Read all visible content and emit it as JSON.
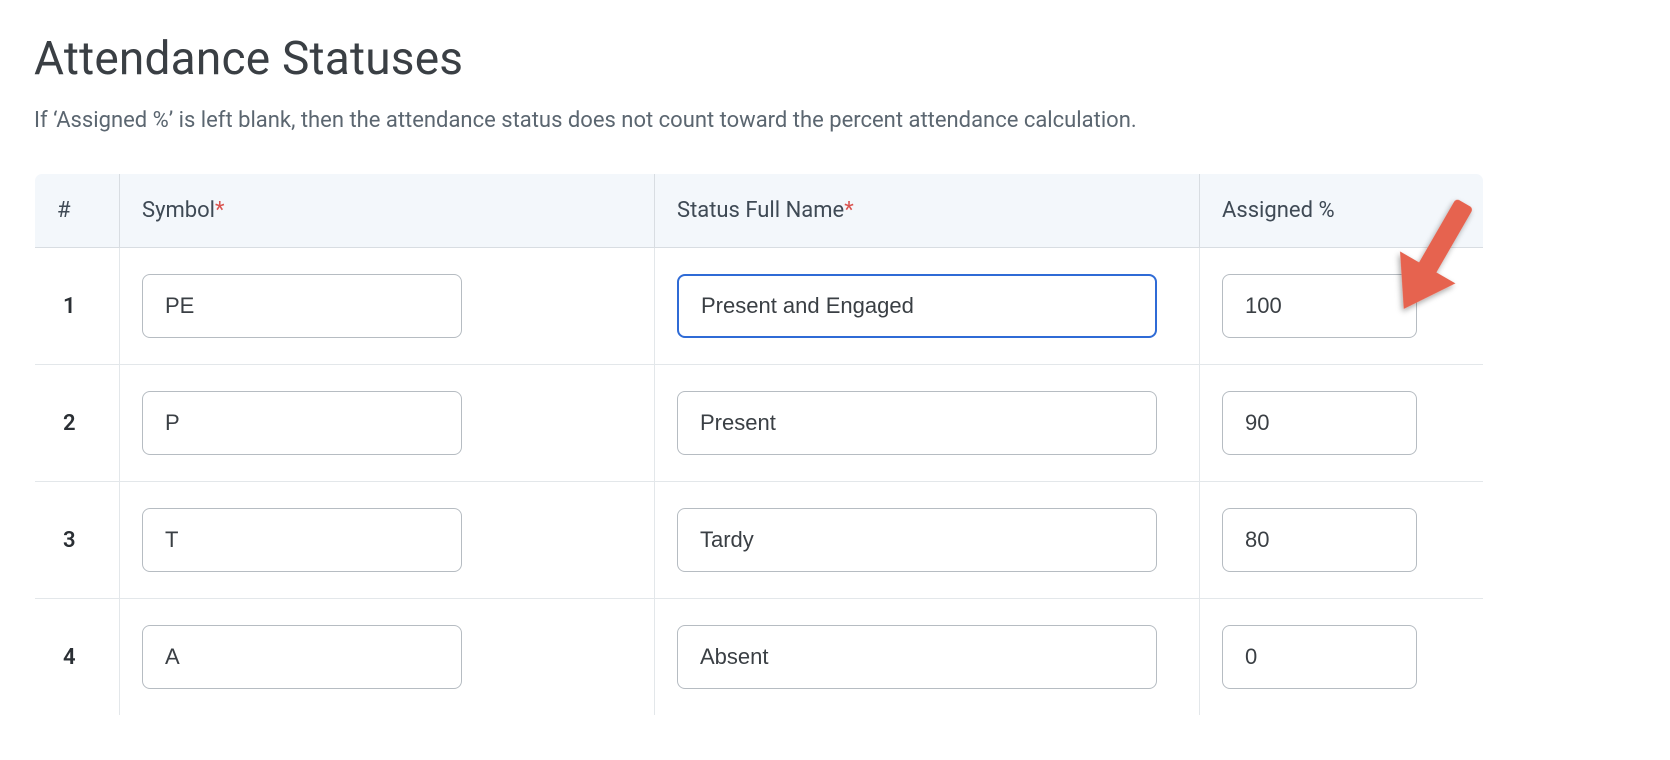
{
  "page": {
    "title": "Attendance Statuses",
    "description": "If ‘Assigned %’ is left blank, then the attendance status does not count toward the percent attendance calculation."
  },
  "table": {
    "headers": {
      "num": "#",
      "symbol": "Symbol",
      "symbol_required": "*",
      "name": "Status Full Name",
      "name_required": "*",
      "pct": "Assigned %"
    },
    "rows": [
      {
        "num": "1",
        "symbol": "PE",
        "name": "Present and Engaged",
        "pct": "100",
        "name_focused": true
      },
      {
        "num": "2",
        "symbol": "P",
        "name": "Present",
        "pct": "90",
        "name_focused": false
      },
      {
        "num": "3",
        "symbol": "T",
        "name": "Tardy",
        "pct": "80",
        "name_focused": false
      },
      {
        "num": "4",
        "symbol": "A",
        "name": "Absent",
        "pct": "0",
        "name_focused": false
      }
    ]
  }
}
